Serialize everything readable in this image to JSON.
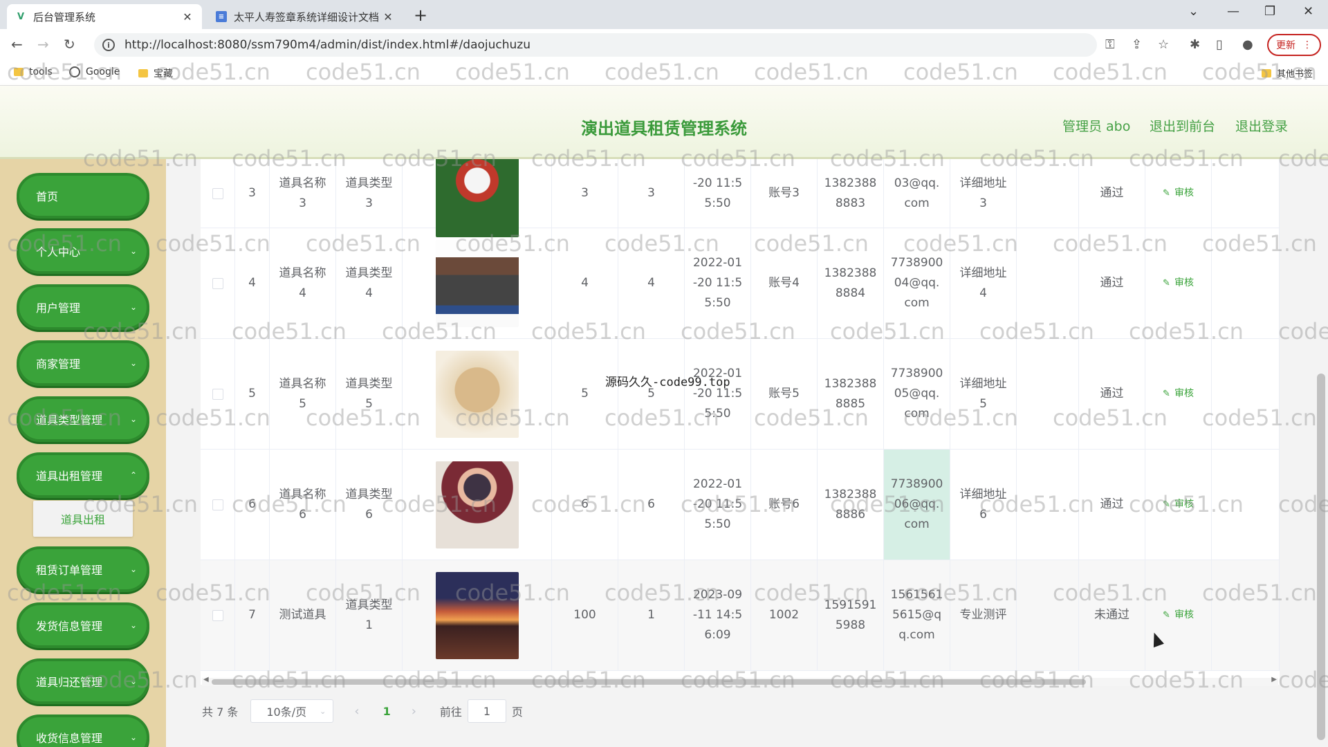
{
  "browser": {
    "tabs": [
      {
        "title": "后台管理系统",
        "close": "✕"
      },
      {
        "title": "太平人寿签章系统详细设计文档",
        "close": "✕"
      }
    ],
    "new_tab": "+",
    "url": "http://localhost:8080/ssm790m4/admin/dist/index.html#/daojuchuzu",
    "update_label": "更新",
    "bookmarks": [
      {
        "label": "tools"
      },
      {
        "label": "Google"
      },
      {
        "label": "宝藏"
      }
    ],
    "other_bookmarks": "其他书签"
  },
  "header": {
    "title": "演出道具租赁管理系统",
    "admin_label": "管理员 abo",
    "to_front": "退出到前台",
    "logout": "退出登录"
  },
  "sidebar": {
    "items": [
      {
        "label": "首页",
        "expandable": false
      },
      {
        "label": "个人中心",
        "expandable": true
      },
      {
        "label": "用户管理",
        "expandable": true
      },
      {
        "label": "商家管理",
        "expandable": true
      },
      {
        "label": "道具类型管理",
        "expandable": true
      },
      {
        "label": "道具出租管理",
        "expandable": true
      },
      {
        "label": "租赁订单管理",
        "expandable": true
      },
      {
        "label": "发货信息管理",
        "expandable": true
      },
      {
        "label": "道具归还管理",
        "expandable": true
      },
      {
        "label": "收货信息管理",
        "expandable": true
      }
    ],
    "submenu_active": "道具出租"
  },
  "table": {
    "rows": [
      {
        "index": "3",
        "name": "道具名称 3",
        "type": "道具类型 3",
        "image": "thumb-doll1",
        "price": "3",
        "qty": "3",
        "date": "-20 11:5 5:50",
        "account": "账号3",
        "phone": "1382388 8883",
        "email": "03@qq. com",
        "address": "详细地址 3",
        "status": "通过",
        "action": "审核"
      },
      {
        "index": "4",
        "name": "道具名称 4",
        "type": "道具类型 4",
        "image": "thumb-temple",
        "price": "4",
        "qty": "4",
        "date": "2022-01 -20 11:5 5:50",
        "account": "账号4",
        "phone": "1382388 8884",
        "email": "7738900 04@qq. com",
        "address": "详细地址 4",
        "status": "通过",
        "action": "审核"
      },
      {
        "index": "5",
        "name": "道具名称 5",
        "type": "道具类型 5",
        "image": "thumb-wood",
        "price": "5",
        "qty": "5",
        "date": "2022-01 -20 11:5 5:50",
        "account": "账号5",
        "phone": "1382388 8885",
        "email": "7738900 05@qq. com",
        "address": "详细地址 5",
        "status": "通过",
        "action": "审核"
      },
      {
        "index": "6",
        "name": "道具名称 6",
        "type": "道具类型 6",
        "image": "thumb-doll2",
        "price": "6",
        "qty": "6",
        "date": "2022-01 -20 11:5 5:50",
        "account": "账号6",
        "phone": "1382388 8886",
        "email": "7738900 06@qq. com",
        "address": "详细地址 6",
        "status": "通过",
        "action": "审核"
      },
      {
        "index": "7",
        "name": "测试道具",
        "type": "道具类型 1",
        "image": "thumb-tree",
        "price": "100",
        "qty": "1",
        "date": "2023-09 -11 14:5 6:09",
        "account": "1002",
        "phone": "1591591 5988",
        "email": "1561561 5615@q q.com",
        "address": "专业测评",
        "status": "未通过",
        "action": "审核"
      }
    ]
  },
  "pagination": {
    "total": "共 7 条",
    "page_size": "10条/页",
    "current_page": "1",
    "goto_label": "前往",
    "goto_value": "1",
    "page_unit": "页"
  },
  "overlay_text": "源码久久-code99.top",
  "watermark": "code51.cn"
}
